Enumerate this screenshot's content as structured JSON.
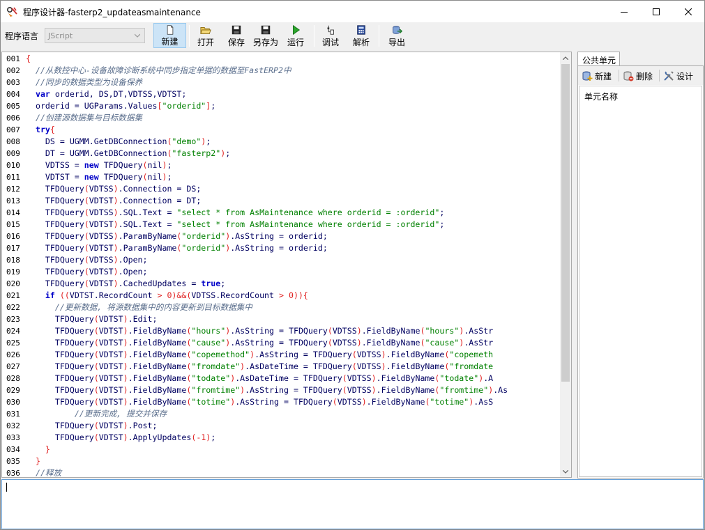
{
  "window": {
    "title": "程序设计器-fasterp2_updateasmaintenance"
  },
  "toolbar": {
    "lang_label": "程序语言",
    "lang_value": "JScript",
    "buttons": [
      {
        "label": "新建",
        "icon": "new-file-icon"
      },
      {
        "label": "打开",
        "icon": "open-folder-icon"
      },
      {
        "label": "保存",
        "icon": "save-icon"
      },
      {
        "label": "另存为",
        "icon": "save-as-icon"
      },
      {
        "label": "运行",
        "icon": "run-icon"
      },
      {
        "label": "调试",
        "icon": "debug-icon"
      },
      {
        "label": "解析",
        "icon": "parse-icon"
      },
      {
        "label": "导出",
        "icon": "export-icon"
      }
    ]
  },
  "editor": {
    "line_numbers": [
      "001",
      "002",
      "003",
      "004",
      "005",
      "006",
      "007",
      "008",
      "009",
      "010",
      "011",
      "012",
      "013",
      "014",
      "015",
      "016",
      "017",
      "018",
      "019",
      "020",
      "021",
      "022",
      "023",
      "024",
      "025",
      "026",
      "027",
      "028",
      "029",
      "030",
      "031",
      "032",
      "033",
      "034",
      "035",
      "036"
    ],
    "lines": [
      [
        [
          "sym",
          "{"
        ]
      ],
      [
        [
          "",
          "  "
        ],
        [
          "cm",
          "//从数控中心-设备故障诊断系统中同步指定单据的数据至FastERP2中"
        ]
      ],
      [
        [
          "",
          "  "
        ],
        [
          "cm",
          "//同步的数据类型为设备保养"
        ]
      ],
      [
        [
          "",
          "  "
        ],
        [
          "kw",
          "var"
        ],
        [
          "id",
          " orderid, DS,DT,VDTSS,VDTST;"
        ]
      ],
      [
        [
          "",
          "  "
        ],
        [
          "id",
          "orderid = UGParams.Values"
        ],
        [
          "sym",
          "["
        ],
        [
          "str",
          "\"orderid\""
        ],
        [
          "sym",
          "]"
        ],
        [
          "id",
          ";"
        ]
      ],
      [
        [
          "",
          "  "
        ],
        [
          "cm",
          "//创建源数据集与目标数据集"
        ]
      ],
      [
        [
          "",
          "  "
        ],
        [
          "kw",
          "try"
        ],
        [
          "sym",
          "{"
        ]
      ],
      [
        [
          "",
          "    "
        ],
        [
          "id",
          "DS = UGMM.GetDBConnection"
        ],
        [
          "sym",
          "("
        ],
        [
          "str",
          "\"demo\""
        ],
        [
          "sym",
          ")"
        ],
        [
          "id",
          ";"
        ]
      ],
      [
        [
          "",
          "    "
        ],
        [
          "id",
          "DT = UGMM.GetDBConnection"
        ],
        [
          "sym",
          "("
        ],
        [
          "str",
          "\"fasterp2\""
        ],
        [
          "sym",
          ")"
        ],
        [
          "id",
          ";"
        ]
      ],
      [
        [
          "",
          "    "
        ],
        [
          "id",
          "VDTSS = "
        ],
        [
          "kw",
          "new"
        ],
        [
          "id",
          " TFDQuery"
        ],
        [
          "sym",
          "("
        ],
        [
          "id",
          "nil"
        ],
        [
          "sym",
          ")"
        ],
        [
          "id",
          ";"
        ]
      ],
      [
        [
          "",
          "    "
        ],
        [
          "id",
          "VDTST = "
        ],
        [
          "kw",
          "new"
        ],
        [
          "id",
          " TFDQuery"
        ],
        [
          "sym",
          "("
        ],
        [
          "id",
          "nil"
        ],
        [
          "sym",
          ")"
        ],
        [
          "id",
          ";"
        ]
      ],
      [
        [
          "",
          "    "
        ],
        [
          "id",
          "TFDQuery"
        ],
        [
          "sym",
          "("
        ],
        [
          "id",
          "VDTSS"
        ],
        [
          "sym",
          ")"
        ],
        [
          "id",
          ".Connection = DS;"
        ]
      ],
      [
        [
          "",
          "    "
        ],
        [
          "id",
          "TFDQuery"
        ],
        [
          "sym",
          "("
        ],
        [
          "id",
          "VDTST"
        ],
        [
          "sym",
          ")"
        ],
        [
          "id",
          ".Connection = DT;"
        ]
      ],
      [
        [
          "",
          "    "
        ],
        [
          "id",
          "TFDQuery"
        ],
        [
          "sym",
          "("
        ],
        [
          "id",
          "VDTSS"
        ],
        [
          "sym",
          ")"
        ],
        [
          "id",
          ".SQL.Text = "
        ],
        [
          "str",
          "\"select * from AsMaintenance where orderid = :orderid\""
        ],
        [
          "id",
          ";"
        ]
      ],
      [
        [
          "",
          "    "
        ],
        [
          "id",
          "TFDQuery"
        ],
        [
          "sym",
          "("
        ],
        [
          "id",
          "VDTST"
        ],
        [
          "sym",
          ")"
        ],
        [
          "id",
          ".SQL.Text = "
        ],
        [
          "str",
          "\"select * from AsMaintenance where orderid = :orderid\""
        ],
        [
          "id",
          ";"
        ]
      ],
      [
        [
          "",
          "    "
        ],
        [
          "id",
          "TFDQuery"
        ],
        [
          "sym",
          "("
        ],
        [
          "id",
          "VDTSS"
        ],
        [
          "sym",
          ")"
        ],
        [
          "id",
          ".ParamByName"
        ],
        [
          "sym",
          "("
        ],
        [
          "str",
          "\"orderid\""
        ],
        [
          "sym",
          ")"
        ],
        [
          "id",
          ".AsString = orderid;"
        ]
      ],
      [
        [
          "",
          "    "
        ],
        [
          "id",
          "TFDQuery"
        ],
        [
          "sym",
          "("
        ],
        [
          "id",
          "VDTST"
        ],
        [
          "sym",
          ")"
        ],
        [
          "id",
          ".ParamByName"
        ],
        [
          "sym",
          "("
        ],
        [
          "str",
          "\"orderid\""
        ],
        [
          "sym",
          ")"
        ],
        [
          "id",
          ".AsString = orderid;"
        ]
      ],
      [
        [
          "",
          "    "
        ],
        [
          "id",
          "TFDQuery"
        ],
        [
          "sym",
          "("
        ],
        [
          "id",
          "VDTSS"
        ],
        [
          "sym",
          ")"
        ],
        [
          "id",
          ".Open;"
        ]
      ],
      [
        [
          "",
          "    "
        ],
        [
          "id",
          "TFDQuery"
        ],
        [
          "sym",
          "("
        ],
        [
          "id",
          "VDTST"
        ],
        [
          "sym",
          ")"
        ],
        [
          "id",
          ".Open;"
        ]
      ],
      [
        [
          "",
          "    "
        ],
        [
          "id",
          "TFDQuery"
        ],
        [
          "sym",
          "("
        ],
        [
          "id",
          "VDTST"
        ],
        [
          "sym",
          ")"
        ],
        [
          "id",
          ".CachedUpdates = "
        ],
        [
          "kw",
          "true"
        ],
        [
          "id",
          ";"
        ]
      ],
      [
        [
          "",
          "    "
        ],
        [
          "kw",
          "if"
        ],
        [
          "id",
          " "
        ],
        [
          "sym",
          "(("
        ],
        [
          "id",
          "VDTST.RecordCount "
        ],
        [
          "sym",
          "> 0)&&("
        ],
        [
          "id",
          "VDTSS.RecordCount "
        ],
        [
          "sym",
          "> 0)){"
        ]
      ],
      [
        [
          "",
          "      "
        ],
        [
          "cm",
          "//更新数据, 将源数据集中的内容更新到目标数据集中"
        ]
      ],
      [
        [
          "",
          "      "
        ],
        [
          "id",
          "TFDQuery"
        ],
        [
          "sym",
          "("
        ],
        [
          "id",
          "VDTST"
        ],
        [
          "sym",
          ")"
        ],
        [
          "id",
          ".Edit;"
        ]
      ],
      [
        [
          "",
          "      "
        ],
        [
          "id",
          "TFDQuery"
        ],
        [
          "sym",
          "("
        ],
        [
          "id",
          "VDTST"
        ],
        [
          "sym",
          ")"
        ],
        [
          "id",
          ".FieldByName"
        ],
        [
          "sym",
          "("
        ],
        [
          "str",
          "\"hours\""
        ],
        [
          "sym",
          ")"
        ],
        [
          "id",
          ".AsString = TFDQuery"
        ],
        [
          "sym",
          "("
        ],
        [
          "id",
          "VDTSS"
        ],
        [
          "sym",
          ")"
        ],
        [
          "id",
          ".FieldByName"
        ],
        [
          "sym",
          "("
        ],
        [
          "str",
          "\"hours\""
        ],
        [
          "sym",
          ")"
        ],
        [
          "id",
          ".AsStr"
        ]
      ],
      [
        [
          "",
          "      "
        ],
        [
          "id",
          "TFDQuery"
        ],
        [
          "sym",
          "("
        ],
        [
          "id",
          "VDTST"
        ],
        [
          "sym",
          ")"
        ],
        [
          "id",
          ".FieldByName"
        ],
        [
          "sym",
          "("
        ],
        [
          "str",
          "\"cause\""
        ],
        [
          "sym",
          ")"
        ],
        [
          "id",
          ".AsString = TFDQuery"
        ],
        [
          "sym",
          "("
        ],
        [
          "id",
          "VDTSS"
        ],
        [
          "sym",
          ")"
        ],
        [
          "id",
          ".FieldByName"
        ],
        [
          "sym",
          "("
        ],
        [
          "str",
          "\"cause\""
        ],
        [
          "sym",
          ")"
        ],
        [
          "id",
          ".AsStr"
        ]
      ],
      [
        [
          "",
          "      "
        ],
        [
          "id",
          "TFDQuery"
        ],
        [
          "sym",
          "("
        ],
        [
          "id",
          "VDTST"
        ],
        [
          "sym",
          ")"
        ],
        [
          "id",
          ".FieldByName"
        ],
        [
          "sym",
          "("
        ],
        [
          "str",
          "\"copemethod\""
        ],
        [
          "sym",
          ")"
        ],
        [
          "id",
          ".AsString = TFDQuery"
        ],
        [
          "sym",
          "("
        ],
        [
          "id",
          "VDTSS"
        ],
        [
          "sym",
          ")"
        ],
        [
          "id",
          ".FieldByName"
        ],
        [
          "sym",
          "("
        ],
        [
          "str",
          "\"copemeth"
        ]
      ],
      [
        [
          "",
          "      "
        ],
        [
          "id",
          "TFDQuery"
        ],
        [
          "sym",
          "("
        ],
        [
          "id",
          "VDTST"
        ],
        [
          "sym",
          ")"
        ],
        [
          "id",
          ".FieldByName"
        ],
        [
          "sym",
          "("
        ],
        [
          "str",
          "\"fromdate\""
        ],
        [
          "sym",
          ")"
        ],
        [
          "id",
          ".AsDateTime = TFDQuery"
        ],
        [
          "sym",
          "("
        ],
        [
          "id",
          "VDTSS"
        ],
        [
          "sym",
          ")"
        ],
        [
          "id",
          ".FieldByName"
        ],
        [
          "sym",
          "("
        ],
        [
          "str",
          "\"fromdate"
        ]
      ],
      [
        [
          "",
          "      "
        ],
        [
          "id",
          "TFDQuery"
        ],
        [
          "sym",
          "("
        ],
        [
          "id",
          "VDTST"
        ],
        [
          "sym",
          ")"
        ],
        [
          "id",
          ".FieldByName"
        ],
        [
          "sym",
          "("
        ],
        [
          "str",
          "\"todate\""
        ],
        [
          "sym",
          ")"
        ],
        [
          "id",
          ".AsDateTime = TFDQuery"
        ],
        [
          "sym",
          "("
        ],
        [
          "id",
          "VDTSS"
        ],
        [
          "sym",
          ")"
        ],
        [
          "id",
          ".FieldByName"
        ],
        [
          "sym",
          "("
        ],
        [
          "str",
          "\"todate\""
        ],
        [
          "sym",
          ")"
        ],
        [
          "id",
          ".A"
        ]
      ],
      [
        [
          "",
          "      "
        ],
        [
          "id",
          "TFDQuery"
        ],
        [
          "sym",
          "("
        ],
        [
          "id",
          "VDTST"
        ],
        [
          "sym",
          ")"
        ],
        [
          "id",
          ".FieldByName"
        ],
        [
          "sym",
          "("
        ],
        [
          "str",
          "\"fromtime\""
        ],
        [
          "sym",
          ")"
        ],
        [
          "id",
          ".AsString = TFDQuery"
        ],
        [
          "sym",
          "("
        ],
        [
          "id",
          "VDTSS"
        ],
        [
          "sym",
          ")"
        ],
        [
          "id",
          ".FieldByName"
        ],
        [
          "sym",
          "("
        ],
        [
          "str",
          "\"fromtime\""
        ],
        [
          "sym",
          ")"
        ],
        [
          "id",
          ".As"
        ]
      ],
      [
        [
          "",
          "      "
        ],
        [
          "id",
          "TFDQuery"
        ],
        [
          "sym",
          "("
        ],
        [
          "id",
          "VDTST"
        ],
        [
          "sym",
          ")"
        ],
        [
          "id",
          ".FieldByName"
        ],
        [
          "sym",
          "("
        ],
        [
          "str",
          "\"totime\""
        ],
        [
          "sym",
          ")"
        ],
        [
          "id",
          ".AsString = TFDQuery"
        ],
        [
          "sym",
          "("
        ],
        [
          "id",
          "VDTSS"
        ],
        [
          "sym",
          ")"
        ],
        [
          "id",
          ".FieldByName"
        ],
        [
          "sym",
          "("
        ],
        [
          "str",
          "\"totime\""
        ],
        [
          "sym",
          ")"
        ],
        [
          "id",
          ".AsS"
        ]
      ],
      [
        [
          "",
          "          "
        ],
        [
          "cm",
          "//更新完成, 提交并保存"
        ]
      ],
      [
        [
          "",
          "      "
        ],
        [
          "id",
          "TFDQuery"
        ],
        [
          "sym",
          "("
        ],
        [
          "id",
          "VDTST"
        ],
        [
          "sym",
          ")"
        ],
        [
          "id",
          ".Post;"
        ]
      ],
      [
        [
          "",
          "      "
        ],
        [
          "id",
          "TFDQuery"
        ],
        [
          "sym",
          "("
        ],
        [
          "id",
          "VDTST"
        ],
        [
          "sym",
          ")"
        ],
        [
          "id",
          ".ApplyUpdates"
        ],
        [
          "sym",
          "(-1)"
        ],
        [
          "id",
          ";"
        ]
      ],
      [
        [
          "",
          "    "
        ],
        [
          "sym",
          "}"
        ]
      ],
      [
        [
          "",
          "  "
        ],
        [
          "sym",
          "}"
        ]
      ],
      [
        [
          "",
          "  "
        ],
        [
          "cm",
          "//释放"
        ]
      ]
    ]
  },
  "panel": {
    "tab_label": "公共单元",
    "new_label": "新建",
    "delete_label": "删除",
    "design_label": "设计",
    "column_header": "单元名称"
  }
}
